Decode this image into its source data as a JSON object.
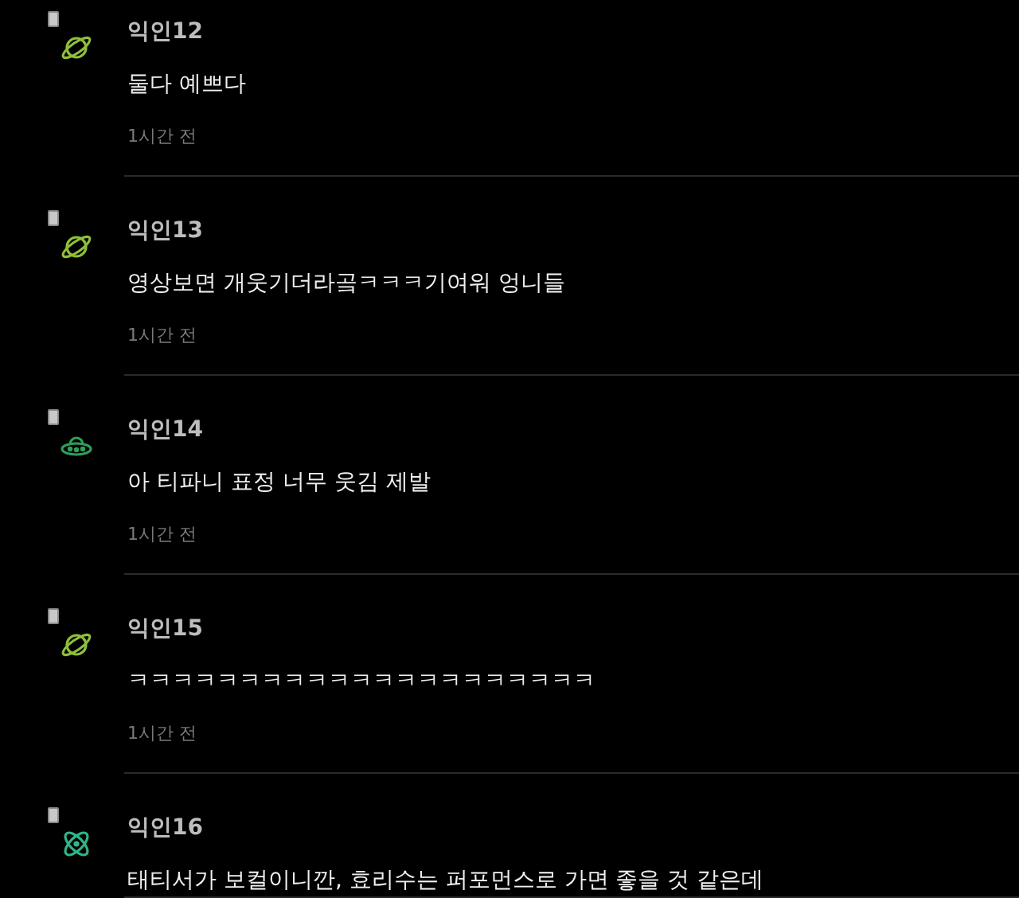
{
  "comments": [
    {
      "avatar": {
        "kind": "planet"
      },
      "name": "익인12",
      "text": "둘다 예쁘다",
      "time": "1시간 전"
    },
    {
      "avatar": {
        "kind": "planet"
      },
      "name": "익인13",
      "text": "영상보면 개웃기더라곸ㅋㅋㅋ기여워 엉니들",
      "time": "1시간 전"
    },
    {
      "avatar": {
        "kind": "ufo"
      },
      "name": "익인14",
      "text": "아 티파니 표정 너무 웃김 제발",
      "time": "1시간 전"
    },
    {
      "avatar": {
        "kind": "planet"
      },
      "name": "익인15",
      "text": "ㅋㅋㅋㅋㅋㅋㅋㅋㅋㅋㅋㅋㅋㅋㅋㅋㅋㅋㅋㅋㅋ",
      "time": "1시간 전"
    },
    {
      "avatar": {
        "kind": "atom"
      },
      "name": "익인16",
      "text": "태티서가 보컬이니깐, 효리수는 퍼포먼스로 가면 좋을 것 같은데"
    }
  ]
}
